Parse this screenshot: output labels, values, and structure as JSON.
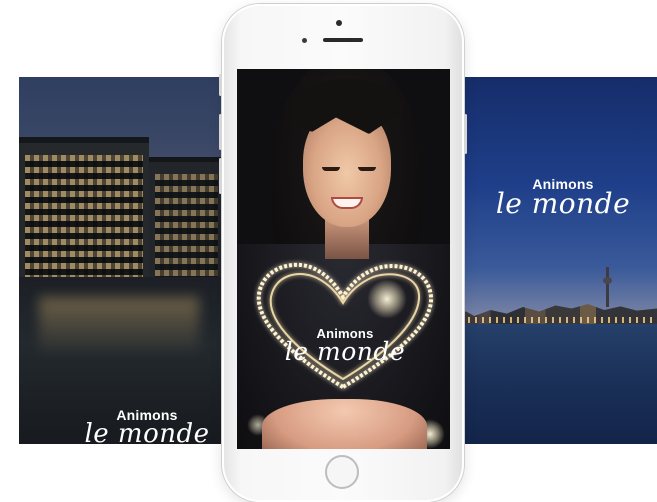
{
  "brand": {
    "line1": "Animons",
    "line2": "le monde"
  },
  "colors": {
    "background": "#ffffff",
    "phone_body": "#f7f7f7",
    "brand_text": "#ffffff",
    "lights": "#fff5dc"
  },
  "icons": {
    "home_button": "home-button-icon",
    "speaker": "speaker-grille-icon",
    "camera": "front-camera-icon"
  }
}
